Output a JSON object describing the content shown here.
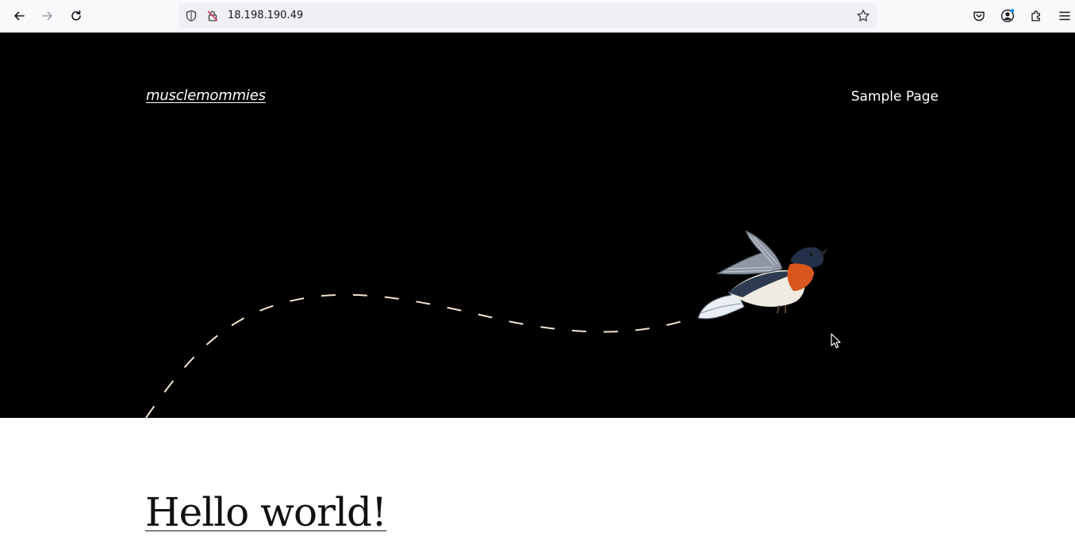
{
  "browser": {
    "url": "18.198.190.49",
    "toolbar_icons": {
      "back": "back-arrow-icon",
      "forward": "forward-arrow-icon",
      "reload": "reload-icon",
      "tracking": "shield-icon",
      "insecure": "lock-slash-icon",
      "bookmark": "star-icon",
      "pocket": "pocket-icon",
      "account": "account-icon",
      "extensions": "puzzle-icon",
      "menu": "hamburger-menu-icon"
    }
  },
  "site": {
    "title": "musclemommies",
    "nav": [
      {
        "label": "Sample Page"
      }
    ]
  },
  "hero": {
    "illustration": "bird-flight-path",
    "background_color": "#000000",
    "path_color": "#f3e4cf"
  },
  "post": {
    "title": "Hello world!"
  }
}
